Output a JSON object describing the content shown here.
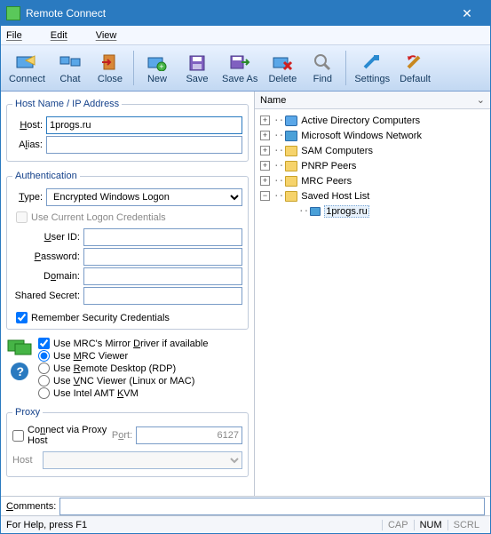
{
  "window": {
    "title": "Remote Connect"
  },
  "menu": {
    "file": "File",
    "edit": "Edit",
    "view": "View"
  },
  "toolbar": {
    "buttons": [
      {
        "id": "connect",
        "label": "Connect"
      },
      {
        "id": "chat",
        "label": "Chat"
      },
      {
        "id": "close",
        "label": "Close"
      },
      {
        "id": "new",
        "label": "New"
      },
      {
        "id": "save",
        "label": "Save"
      },
      {
        "id": "saveas",
        "label": "Save As"
      },
      {
        "id": "delete",
        "label": "Delete"
      },
      {
        "id": "find",
        "label": "Find"
      },
      {
        "id": "settings",
        "label": "Settings"
      },
      {
        "id": "default",
        "label": "Default"
      }
    ]
  },
  "host_group": {
    "legend": "Host Name / IP Address",
    "host_label": "Host:",
    "host_value": "1progs.ru",
    "alias_label": "Alias:",
    "alias_value": ""
  },
  "auth_group": {
    "legend": "Authentication",
    "type_label": "Type:",
    "type_value": "Encrypted Windows Logon",
    "use_current_label": "Use Current Logon Credentials",
    "use_current_checked": false,
    "userid_label": "User ID:",
    "userid_value": "",
    "password_label": "Password:",
    "password_value": "",
    "domain_label": "Domain:",
    "domain_value": "",
    "secret_label": "Shared Secret:",
    "secret_value": "",
    "remember_label": "Remember Security Credentials",
    "remember_checked": true
  },
  "options": {
    "mirror_label": "Use MRC's Mirror Driver if available",
    "mirror_checked": true,
    "viewer_selected": "mrc",
    "mrc_label": "Use MRC Viewer",
    "rdp_label": "Use Remote Desktop (RDP)",
    "vnc_label": "Use VNC Viewer (Linux or MAC)",
    "amt_label": "Use Intel AMT KVM"
  },
  "proxy_group": {
    "legend": "Proxy",
    "connect_label": "Connect via Proxy Host",
    "connect_checked": false,
    "port_label": "Port:",
    "port_value": "6127",
    "host_label": "Host",
    "host_value": ""
  },
  "comments": {
    "label": "Comments:",
    "value": ""
  },
  "right": {
    "header": "Name",
    "tree": [
      {
        "id": "ad",
        "label": "Active Directory Computers",
        "expandable": true,
        "expanded": false,
        "level": 0,
        "icon": "folder-blue"
      },
      {
        "id": "mwn",
        "label": "Microsoft Windows Network",
        "expandable": true,
        "expanded": false,
        "level": 0,
        "icon": "net"
      },
      {
        "id": "sam",
        "label": "SAM Computers",
        "expandable": true,
        "expanded": false,
        "level": 0,
        "icon": "folder"
      },
      {
        "id": "pnrp",
        "label": "PNRP Peers",
        "expandable": true,
        "expanded": false,
        "level": 0,
        "icon": "folder"
      },
      {
        "id": "mrc",
        "label": "MRC Peers",
        "expandable": true,
        "expanded": false,
        "level": 0,
        "icon": "folder"
      },
      {
        "id": "shl",
        "label": "Saved Host List",
        "expandable": true,
        "expanded": true,
        "level": 0,
        "icon": "folder-open"
      },
      {
        "id": "host1",
        "label": "1progs.ru",
        "expandable": false,
        "expanded": false,
        "level": 1,
        "icon": "host",
        "selected": true
      }
    ]
  },
  "statusbar": {
    "help": "For Help, press F1",
    "cap": "CAP",
    "num": "NUM",
    "scrl": "SCRL"
  }
}
